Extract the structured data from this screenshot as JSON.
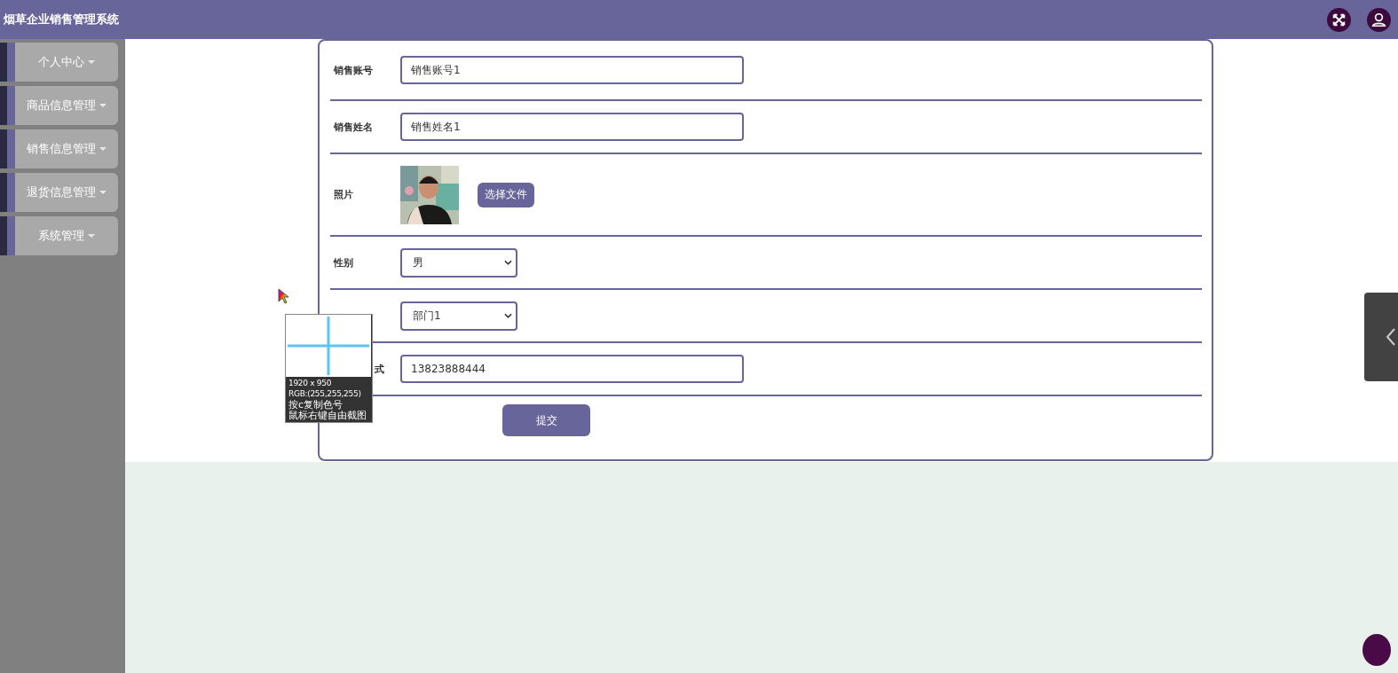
{
  "header": {
    "title": "烟草企业销售管理系统"
  },
  "sidebar": {
    "items": [
      {
        "label": "个人中心"
      },
      {
        "label": "商品信息管理"
      },
      {
        "label": "销售信息管理"
      },
      {
        "label": "退货信息管理"
      },
      {
        "label": "系统管理"
      }
    ]
  },
  "form": {
    "rows": [
      {
        "kind": "text",
        "label": "销售账号",
        "value": "销售账号1"
      },
      {
        "kind": "text",
        "label": "销售姓名",
        "value": "销售姓名1"
      },
      {
        "label": "照片",
        "button": "选择文件"
      },
      {
        "kind": "select",
        "label": "性别",
        "value": "男"
      },
      {
        "kind": "select",
        "value": "部门1"
      },
      {
        "kind": "text",
        "label": "式",
        "covered": true,
        "value": "13823888444"
      }
    ],
    "submit": "提交"
  },
  "color_picker": {
    "size": "1920 x 950",
    "rgb": "RGB:(255,255,255)",
    "hint_1": "按c复制色号",
    "hint_2": "鼠标右键自由截图"
  }
}
